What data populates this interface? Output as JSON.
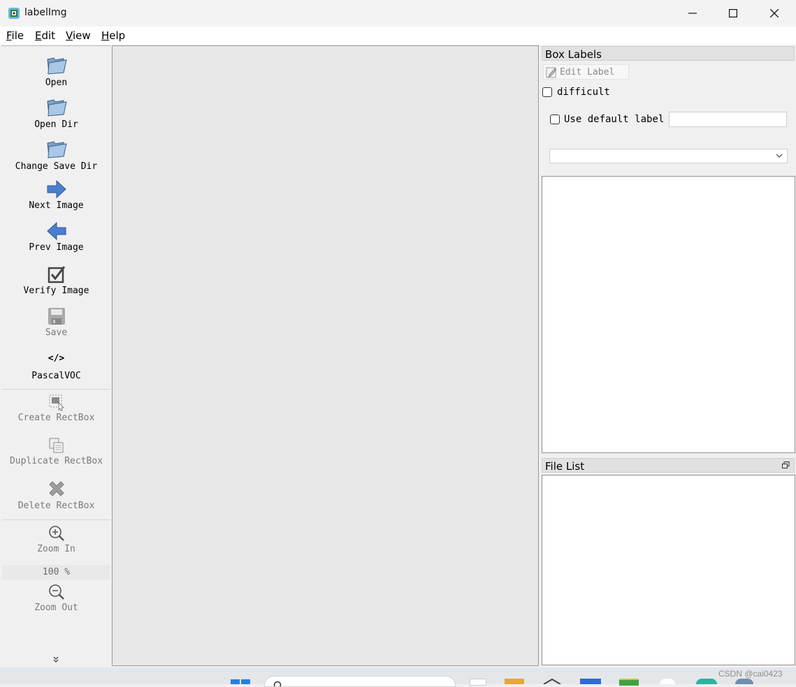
{
  "window": {
    "title": "labelImg"
  },
  "menu": {
    "items": [
      {
        "label": "File",
        "mnemonic": "F",
        "rest": "ile"
      },
      {
        "label": "Edit",
        "mnemonic": "E",
        "rest": "dit"
      },
      {
        "label": "View",
        "mnemonic": "V",
        "rest": "iew"
      },
      {
        "label": "Help",
        "mnemonic": "H",
        "rest": "elp"
      }
    ]
  },
  "toolbar": {
    "open": "Open",
    "open_dir": "Open Dir",
    "change_save_dir": "Change Save Dir",
    "next_image": "Next Image",
    "prev_image": "Prev Image",
    "verify_image": "Verify Image",
    "save": "Save",
    "format_icon_text": "</>",
    "format": "PascalVOC",
    "create_rectbox": "Create RectBox",
    "duplicate_rectbox": "Duplicate RectBox",
    "delete_rectbox": "Delete RectBox",
    "zoom_in": "Zoom In",
    "zoom_value": "100 %",
    "zoom_out": "Zoom Out",
    "extension_arrow": "»"
  },
  "box_labels": {
    "title": "Box Labels",
    "edit_label": "Edit Label",
    "difficult": "difficult",
    "use_default_label": "Use default label",
    "default_label_value": "",
    "combo_value": ""
  },
  "file_list": {
    "title": "File List"
  },
  "taskbar": {
    "watermark": "CSDN @cai0423"
  },
  "colors": {
    "accent_blue": "#3f79c6",
    "canvas": "#e8e8e8",
    "panel": "#f0f0f0"
  }
}
